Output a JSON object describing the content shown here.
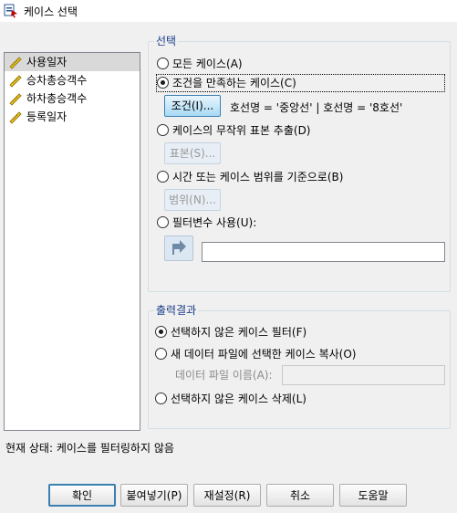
{
  "window": {
    "title": "케이스 선택"
  },
  "variables": [
    {
      "label": "사용일자",
      "selected": true
    },
    {
      "label": "승차총승객수",
      "selected": false
    },
    {
      "label": "하차총승객수",
      "selected": false
    },
    {
      "label": "등록일자",
      "selected": false
    }
  ],
  "selection": {
    "legend": "선택",
    "all_cases": "모든 케이스(A)",
    "if_condition": "조건을 만족하는 케이스(C)",
    "if_button": "조건(I)...",
    "condition_text": "호선명 = '중앙선' | 호선명 = '8호선'",
    "random_sample": "케이스의 무작위 표본 추출(D)",
    "sample_button": "표본(S)...",
    "based_on_range": "시간 또는 케이스 범위를 기준으로(B)",
    "range_button": "범위(N)...",
    "filter_variable": "필터변수 사용(U):",
    "filter_value": ""
  },
  "output": {
    "legend": "출력결과",
    "filter_out": "선택하지 않은 케이스 필터(F)",
    "copy_to_new": "새 데이터 파일에 선택한 케이스 복사(O)",
    "dataset_label": "데이터 파일 이름(A):",
    "dataset_value": "",
    "delete_unselected": "선택하지 않은 케이스 삭제(L)"
  },
  "status": "현재 상태: 케이스를 필터링하지 않음",
  "buttons": {
    "ok": "확인",
    "paste": "붙여넣기(P)",
    "reset": "재설정(R)",
    "cancel": "취소",
    "help": "도움말"
  },
  "colors": {
    "legend": "#1c3e8a",
    "active_button": "#a7d9f5",
    "selected_item": "#d9d9d9"
  }
}
